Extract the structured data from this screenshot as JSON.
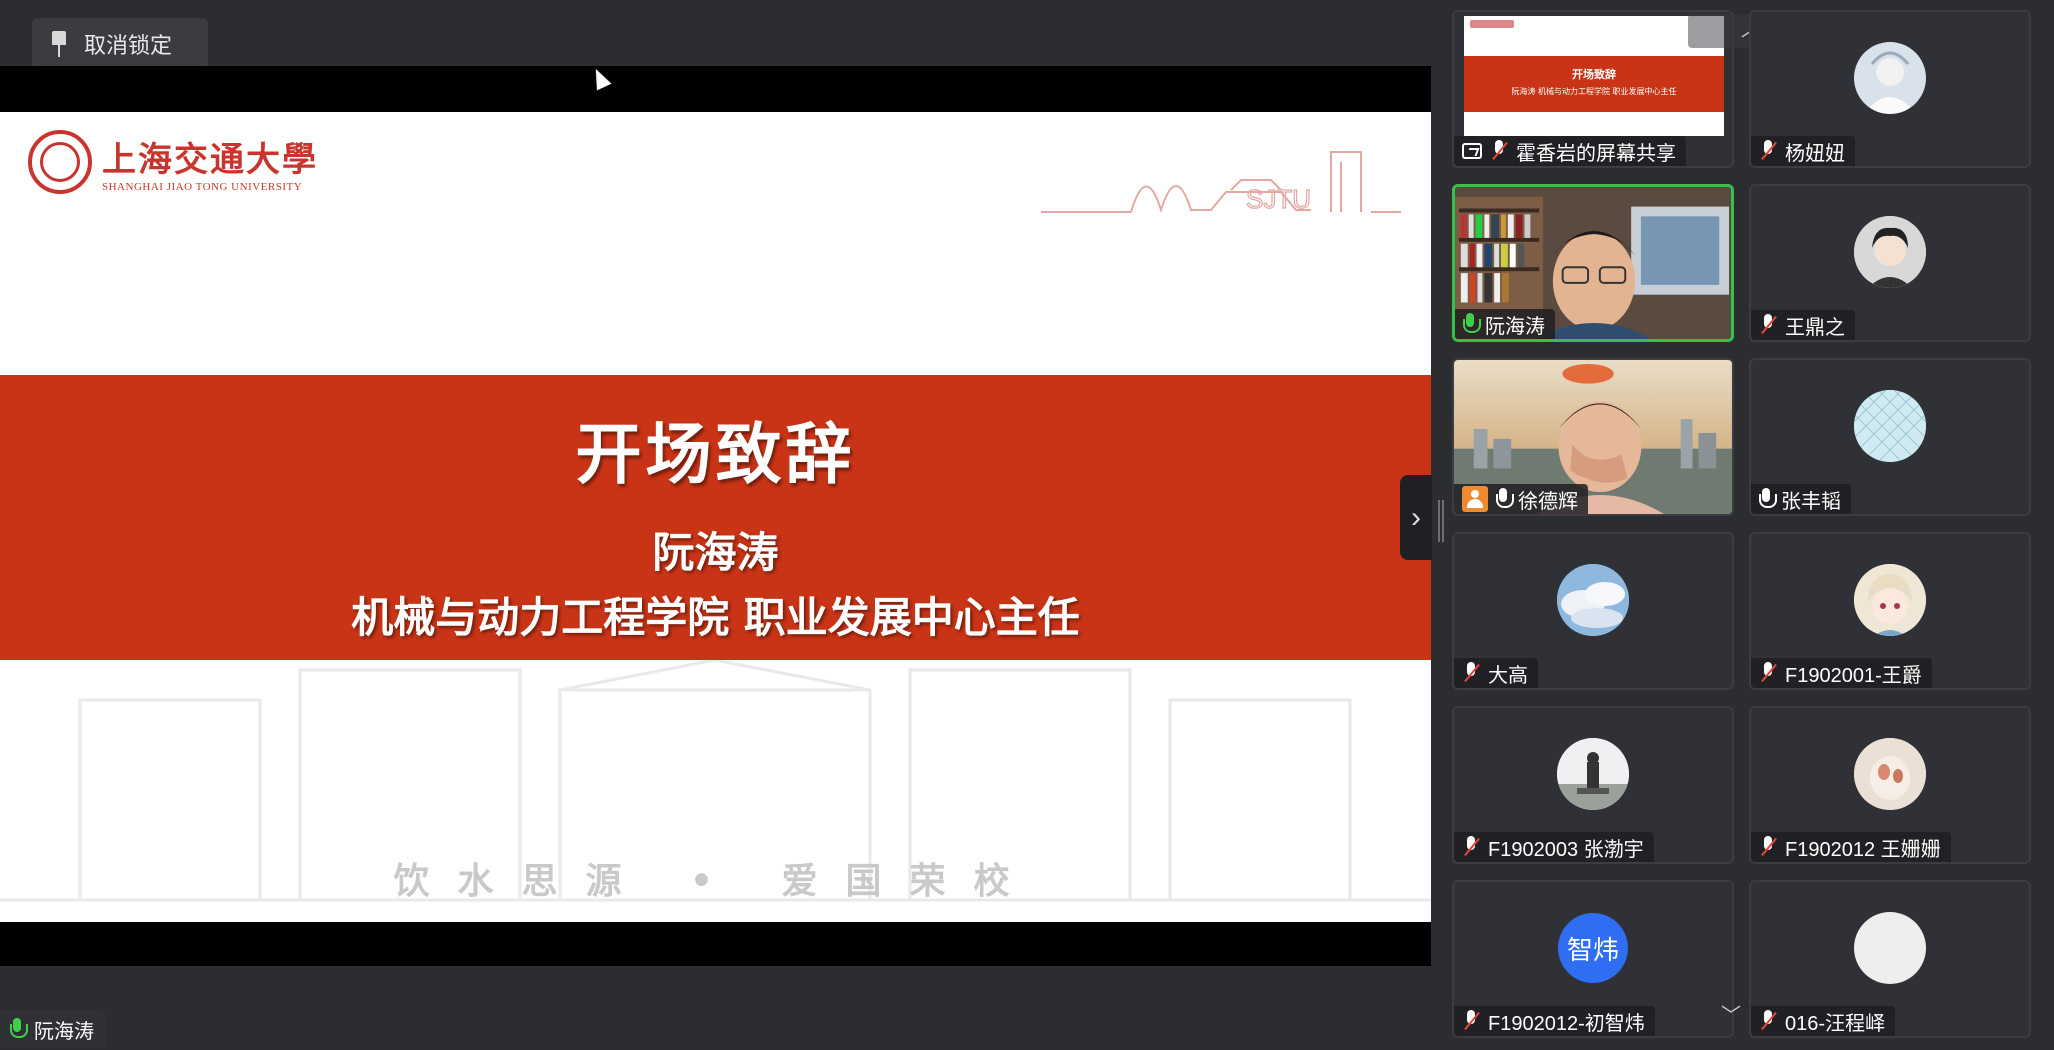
{
  "toolbar": {
    "unpin_label": "取消锁定"
  },
  "slide": {
    "university_cn": "上海交通大學",
    "university_en": "SHANGHAI JIAO TONG UNIVERSITY",
    "sketch_text": "SJTU",
    "title": "开场致辞",
    "presenter": "阮海涛",
    "role": "机械与动力工程学院 职业发展中心主任",
    "motto": "饮水思源 • 爱国荣校",
    "band_color": "#c93416"
  },
  "active_speaker": {
    "name": "阮海涛"
  },
  "gallery": {
    "tiles": [
      {
        "name": "霍香岩的屏幕共享",
        "type": "screen-share",
        "muted": true
      },
      {
        "name": "杨妞妞",
        "type": "avatar",
        "muted": true
      },
      {
        "name": "阮海涛",
        "type": "video",
        "muted": false,
        "active": true
      },
      {
        "name": "王鼎之",
        "type": "avatar",
        "muted": true
      },
      {
        "name": "徐德辉",
        "type": "video",
        "muted": false
      },
      {
        "name": "张丰韬",
        "type": "avatar",
        "muted": false
      },
      {
        "name": "大高",
        "type": "avatar",
        "muted": true
      },
      {
        "name": "F1902001-王爵",
        "type": "avatar",
        "muted": true
      },
      {
        "name": "F1902003 张渤宇",
        "type": "avatar",
        "muted": true
      },
      {
        "name": "F1902012 王姗姗",
        "type": "avatar",
        "muted": true
      },
      {
        "name": "F1902012-初智炜",
        "type": "initials",
        "initials": "智炜",
        "muted": true
      },
      {
        "name": "016-汪程峄",
        "type": "avatar",
        "muted": true
      }
    ],
    "thumb_title": "开场致辞",
    "thumb_subtitle": "阮海涛 机械与动力工程学院 职业发展中心主任"
  },
  "colors": {
    "accent_green": "#35c24a",
    "muted_red": "#e0463b",
    "initials_blue": "#2f6df2"
  }
}
